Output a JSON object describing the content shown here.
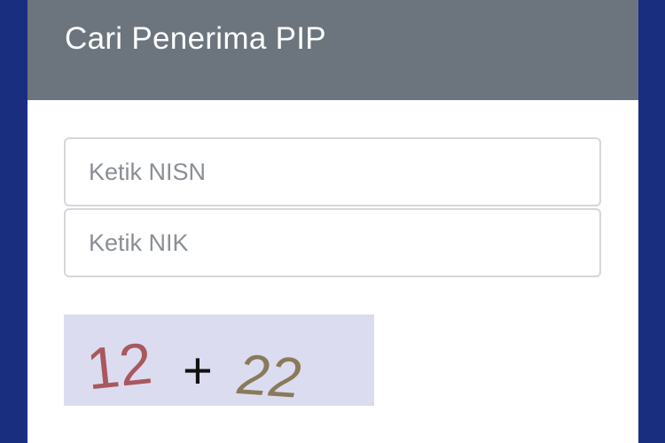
{
  "header": {
    "title": "Cari Penerima PIP"
  },
  "form": {
    "nisn_placeholder": "Ketik NISN",
    "nisn_value": "",
    "nik_placeholder": "Ketik NIK",
    "nik_value": ""
  },
  "captcha": {
    "operand_1": "12",
    "operator": "+",
    "operand_2": "22",
    "colors": {
      "background": "#dcdcf0",
      "operand_1": "#a8585e",
      "operator": "#111111",
      "operand_2": "#8a7a5a"
    }
  },
  "colors": {
    "page_background": "#1a2e80",
    "header_background": "#6c757d",
    "card_background": "#ffffff"
  }
}
